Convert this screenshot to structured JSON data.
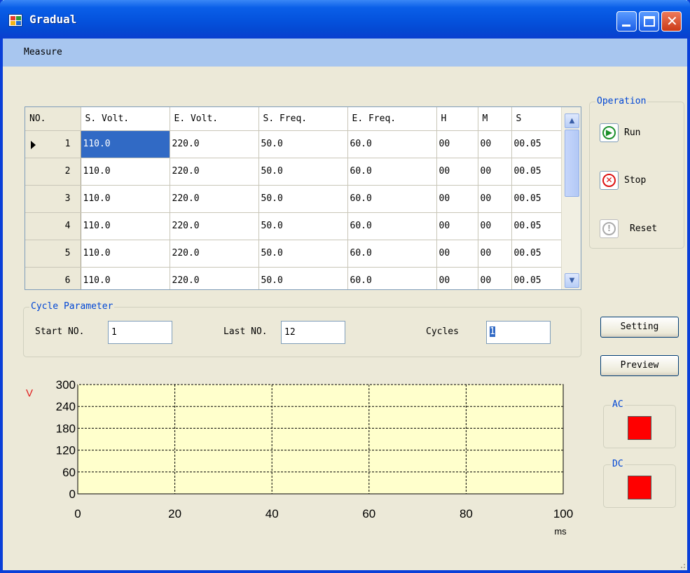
{
  "window": {
    "title": "Gradual"
  },
  "menu": {
    "measure": "Measure"
  },
  "grid": {
    "headers": [
      "NO.",
      "S. Volt.",
      "E. Volt.",
      "S. Freq.",
      "E. Freq.",
      "H",
      "M",
      "S"
    ],
    "rows": [
      {
        "no": "1",
        "s_volt": "110.0",
        "e_volt": "220.0",
        "s_freq": "50.0",
        "e_freq": "60.0",
        "h": "00",
        "m": "00",
        "s": "00.05"
      },
      {
        "no": "2",
        "s_volt": "110.0",
        "e_volt": "220.0",
        "s_freq": "50.0",
        "e_freq": "60.0",
        "h": "00",
        "m": "00",
        "s": "00.05"
      },
      {
        "no": "3",
        "s_volt": "110.0",
        "e_volt": "220.0",
        "s_freq": "50.0",
        "e_freq": "60.0",
        "h": "00",
        "m": "00",
        "s": "00.05"
      },
      {
        "no": "4",
        "s_volt": "110.0",
        "e_volt": "220.0",
        "s_freq": "50.0",
        "e_freq": "60.0",
        "h": "00",
        "m": "00",
        "s": "00.05"
      },
      {
        "no": "5",
        "s_volt": "110.0",
        "e_volt": "220.0",
        "s_freq": "50.0",
        "e_freq": "60.0",
        "h": "00",
        "m": "00",
        "s": "00.05"
      },
      {
        "no": "6",
        "s_volt": "110.0",
        "e_volt": "220.0",
        "s_freq": "50.0",
        "e_freq": "60.0",
        "h": "00",
        "m": "00",
        "s": "00.05"
      }
    ]
  },
  "operation": {
    "title": "Operation",
    "run_label": "Run",
    "stop_label": "Stop",
    "reset_label": "Reset"
  },
  "cycle": {
    "title": "Cycle Parameter",
    "start_label": "Start NO.",
    "start_value": "1",
    "last_label": "Last NO.",
    "last_value": "12",
    "cycles_label": "Cycles",
    "cycles_value": "1"
  },
  "buttons": {
    "setting": "Setting",
    "preview": "Preview"
  },
  "indicators": {
    "ac_label": "AC",
    "dc_label": "DC",
    "ac_color": "#ff0000",
    "dc_color": "#ff0000"
  },
  "chart_data": {
    "type": "line",
    "ylabel": "V",
    "xlabel": "ms",
    "xlim": [
      0,
      100
    ],
    "ylim": [
      0,
      300
    ],
    "x_ticks": [
      0,
      20,
      40,
      60,
      80,
      100
    ],
    "y_ticks": [
      0,
      60,
      120,
      180,
      240,
      300
    ],
    "grid": true,
    "background": "#ffffcc",
    "series": []
  }
}
